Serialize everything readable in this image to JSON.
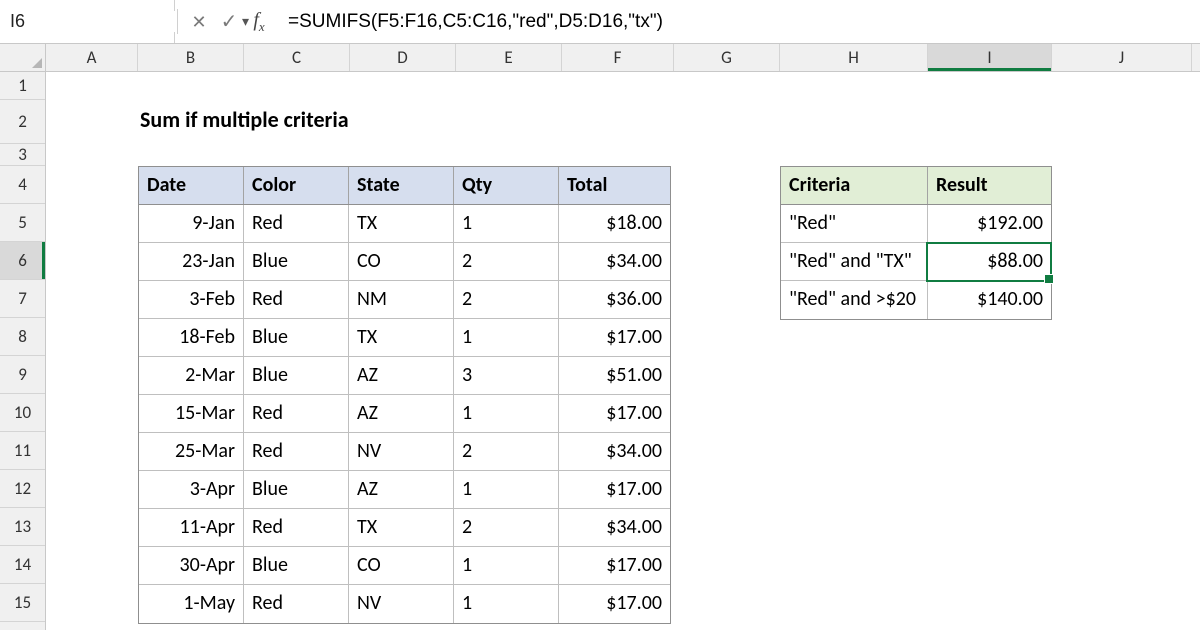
{
  "formula_bar": {
    "cell_ref": "I6",
    "formula": "=SUMIFS(F5:F16,C5:C16,\"red\",D5:D16,\"tx\")"
  },
  "columns": [
    "A",
    "B",
    "C",
    "D",
    "E",
    "F",
    "G",
    "H",
    "I",
    "J"
  ],
  "rows": [
    "1",
    "2",
    "3",
    "4",
    "5",
    "6",
    "7",
    "8",
    "9",
    "10",
    "11",
    "12",
    "13",
    "14",
    "15"
  ],
  "active_col": "I",
  "active_row": "6",
  "title": "Sum if multiple criteria",
  "table1": {
    "headers": [
      "Date",
      "Color",
      "State",
      "Qty",
      "Total"
    ],
    "rows": [
      [
        "9-Jan",
        "Red",
        "TX",
        "1",
        "$18.00"
      ],
      [
        "23-Jan",
        "Blue",
        "CO",
        "2",
        "$34.00"
      ],
      [
        "3-Feb",
        "Red",
        "NM",
        "2",
        "$36.00"
      ],
      [
        "18-Feb",
        "Blue",
        "TX",
        "1",
        "$17.00"
      ],
      [
        "2-Mar",
        "Blue",
        "AZ",
        "3",
        "$51.00"
      ],
      [
        "15-Mar",
        "Red",
        "AZ",
        "1",
        "$17.00"
      ],
      [
        "25-Mar",
        "Red",
        "NV",
        "2",
        "$34.00"
      ],
      [
        "3-Apr",
        "Blue",
        "AZ",
        "1",
        "$17.00"
      ],
      [
        "11-Apr",
        "Red",
        "TX",
        "2",
        "$34.00"
      ],
      [
        "30-Apr",
        "Blue",
        "CO",
        "1",
        "$17.00"
      ],
      [
        "1-May",
        "Red",
        "NV",
        "1",
        "$17.00"
      ]
    ]
  },
  "table2": {
    "headers": [
      "Criteria",
      "Result"
    ],
    "rows": [
      [
        "\"Red\"",
        "$192.00"
      ],
      [
        "\"Red\" and \"TX\"",
        "$88.00"
      ],
      [
        "\"Red\" and >$20",
        "$140.00"
      ]
    ]
  }
}
